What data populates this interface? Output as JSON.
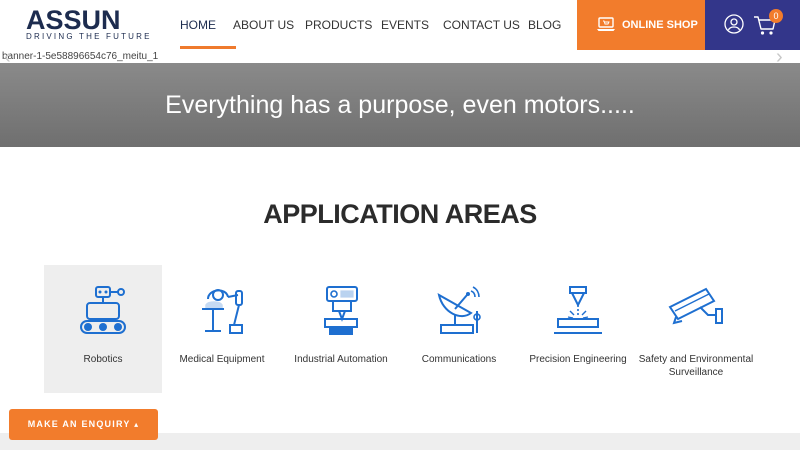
{
  "brand": {
    "name": "ASSUN",
    "tagline": "DRIVING THE FUTURE",
    "logo_color": "#1d2c4f",
    "accent_color": "#1e6fd0"
  },
  "nav": {
    "items": [
      {
        "label": "HOME",
        "active": true
      },
      {
        "label": "ABOUT US",
        "active": false
      },
      {
        "label": "PRODUCTS",
        "active": false
      },
      {
        "label": "EVENTS",
        "active": false
      },
      {
        "label": "CONTACT US",
        "active": false
      },
      {
        "label": "BLOG",
        "active": false
      }
    ],
    "underline_color": "#ef7a2d"
  },
  "shop": {
    "label": "ONLINE SHOP",
    "icon": "laptop-cart-icon",
    "color": "#f27c2c"
  },
  "account": {
    "user_icon": "user-icon",
    "cart_icon": "cart-icon",
    "cart_count": "0",
    "panel_color": "#33368a"
  },
  "banner": {
    "image_alt": "banner-1-5e58896654c76_meitu_1",
    "headline": "Everything has a purpose, even motors....."
  },
  "applications": {
    "title": "APPLICATION AREAS",
    "items": [
      {
        "label": "Robotics",
        "icon": "robot-icon"
      },
      {
        "label": "Medical Equipment",
        "icon": "medical-equipment-icon"
      },
      {
        "label": "Industrial Automation",
        "icon": "industrial-machine-icon"
      },
      {
        "label": "Communications",
        "icon": "satellite-dish-icon"
      },
      {
        "label": "Precision Engineering",
        "icon": "laser-cutter-icon"
      },
      {
        "label": "Safety and Environmental Surveillance",
        "icon": "security-camera-icon"
      }
    ]
  },
  "enquiry": {
    "label": "MAKE AN ENQUIRY",
    "icon": "chevron-up-icon"
  }
}
